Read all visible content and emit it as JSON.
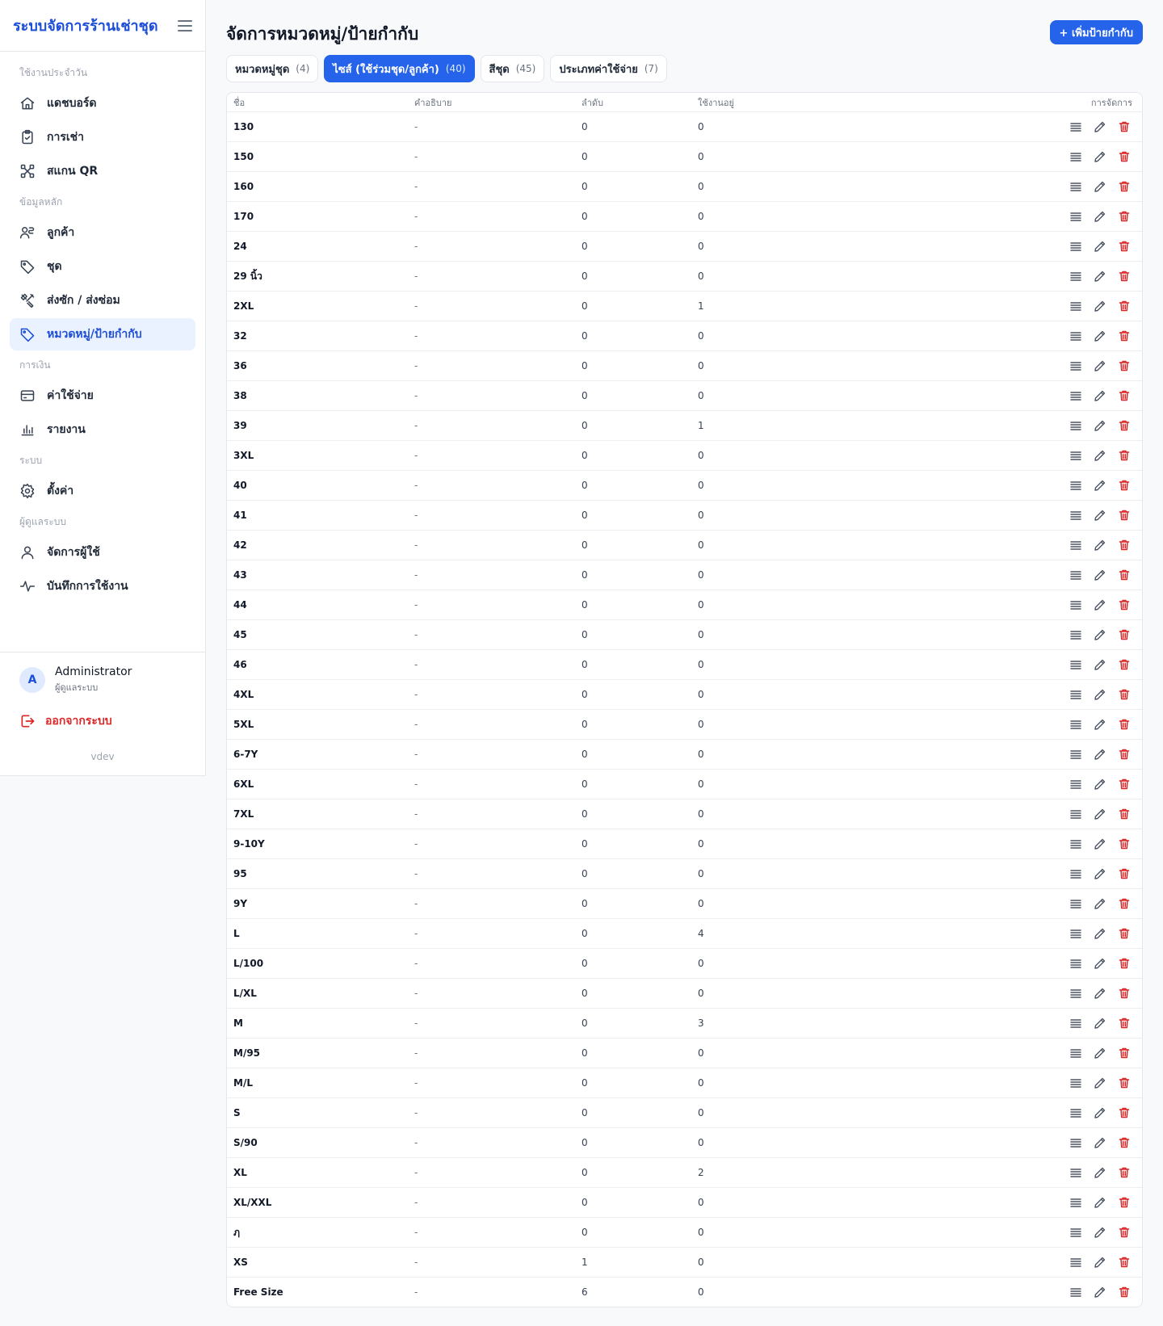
{
  "app": {
    "brand_title": "ระบบจัดการร้านเช่าชุด",
    "version": "vdev"
  },
  "sidebar": {
    "sections": [
      {
        "label": "ใช้งานประจำวัน",
        "items": [
          {
            "label": "แดชบอร์ด",
            "icon": "home-icon"
          },
          {
            "label": "การเช่า",
            "icon": "clipboard-check-icon"
          },
          {
            "label": "สแกน QR",
            "icon": "qr-scan-icon"
          }
        ]
      },
      {
        "label": "ข้อมูลหลัก",
        "items": [
          {
            "label": "ลูกค้า",
            "icon": "users-icon"
          },
          {
            "label": "ชุด",
            "icon": "tag-icon"
          },
          {
            "label": "ส่งซัก / ส่งซ่อม",
            "icon": "tools-icon"
          },
          {
            "label": "หมวดหมู่/ป้ายกำกับ",
            "icon": "tag-icon",
            "active": true
          }
        ]
      },
      {
        "label": "การเงิน",
        "items": [
          {
            "label": "ค่าใช้จ่าย",
            "icon": "wallet-icon"
          },
          {
            "label": "รายงาน",
            "icon": "bar-chart-icon"
          }
        ]
      },
      {
        "label": "ระบบ",
        "items": [
          {
            "label": "ตั้งค่า",
            "icon": "gear-icon"
          }
        ]
      },
      {
        "label": "ผู้ดูแลระบบ",
        "items": [
          {
            "label": "จัดการผู้ใช้",
            "icon": "user-icon"
          },
          {
            "label": "บันทึกการใช้งาน",
            "icon": "activity-icon"
          }
        ]
      }
    ],
    "profile": {
      "avatar_letter": "A",
      "name": "Administrator",
      "role": "ผู้ดูแลระบบ"
    },
    "logout_label": "ออกจากระบบ"
  },
  "main": {
    "title": "จัดการหมวดหมู่/ป้ายกำกับ",
    "add_button": "+ เพิ่มป้ายกำกับ",
    "tabs": [
      {
        "label": "หมวดหมู่ชุด",
        "count": "(4)",
        "active": false
      },
      {
        "label": "ไซส์ (ใช้ร่วมชุด/ลูกค้า)",
        "count": "(40)",
        "active": true
      },
      {
        "label": "สีชุด",
        "count": "(45)",
        "active": false
      },
      {
        "label": "ประเภทค่าใช้จ่าย",
        "count": "(7)",
        "active": false
      }
    ],
    "table": {
      "headers": {
        "name": "ชื่อ",
        "description": "คำอธิบาย",
        "order": "ลำดับ",
        "used": "ใช้งานอยู่",
        "actions": "การจัดการ"
      },
      "rows": [
        {
          "name": "130",
          "description": "-",
          "order": "0",
          "used": "0"
        },
        {
          "name": "150",
          "description": "-",
          "order": "0",
          "used": "0"
        },
        {
          "name": "160",
          "description": "-",
          "order": "0",
          "used": "0"
        },
        {
          "name": "170",
          "description": "-",
          "order": "0",
          "used": "0"
        },
        {
          "name": "24",
          "description": "-",
          "order": "0",
          "used": "0"
        },
        {
          "name": "29 นิ้ว",
          "description": "-",
          "order": "0",
          "used": "0"
        },
        {
          "name": "2XL",
          "description": "-",
          "order": "0",
          "used": "1"
        },
        {
          "name": "32",
          "description": "-",
          "order": "0",
          "used": "0"
        },
        {
          "name": "36",
          "description": "-",
          "order": "0",
          "used": "0"
        },
        {
          "name": "38",
          "description": "-",
          "order": "0",
          "used": "0"
        },
        {
          "name": "39",
          "description": "-",
          "order": "0",
          "used": "1"
        },
        {
          "name": "3XL",
          "description": "-",
          "order": "0",
          "used": "0"
        },
        {
          "name": "40",
          "description": "-",
          "order": "0",
          "used": "0"
        },
        {
          "name": "41",
          "description": "-",
          "order": "0",
          "used": "0"
        },
        {
          "name": "42",
          "description": "-",
          "order": "0",
          "used": "0"
        },
        {
          "name": "43",
          "description": "-",
          "order": "0",
          "used": "0"
        },
        {
          "name": "44",
          "description": "-",
          "order": "0",
          "used": "0"
        },
        {
          "name": "45",
          "description": "-",
          "order": "0",
          "used": "0"
        },
        {
          "name": "46",
          "description": "-",
          "order": "0",
          "used": "0"
        },
        {
          "name": "4XL",
          "description": "-",
          "order": "0",
          "used": "0"
        },
        {
          "name": "5XL",
          "description": "-",
          "order": "0",
          "used": "0"
        },
        {
          "name": "6-7Y",
          "description": "-",
          "order": "0",
          "used": "0"
        },
        {
          "name": "6XL",
          "description": "-",
          "order": "0",
          "used": "0"
        },
        {
          "name": "7XL",
          "description": "-",
          "order": "0",
          "used": "0"
        },
        {
          "name": "9-10Y",
          "description": "-",
          "order": "0",
          "used": "0"
        },
        {
          "name": "95",
          "description": "-",
          "order": "0",
          "used": "0"
        },
        {
          "name": "9Y",
          "description": "-",
          "order": "0",
          "used": "0"
        },
        {
          "name": "L",
          "description": "-",
          "order": "0",
          "used": "4"
        },
        {
          "name": "L/100",
          "description": "-",
          "order": "0",
          "used": "0"
        },
        {
          "name": "L/XL",
          "description": "-",
          "order": "0",
          "used": "0"
        },
        {
          "name": "M",
          "description": "-",
          "order": "0",
          "used": "3"
        },
        {
          "name": "M/95",
          "description": "-",
          "order": "0",
          "used": "0"
        },
        {
          "name": "M/L",
          "description": "-",
          "order": "0",
          "used": "0"
        },
        {
          "name": "S",
          "description": "-",
          "order": "0",
          "used": "0"
        },
        {
          "name": "S/90",
          "description": "-",
          "order": "0",
          "used": "0"
        },
        {
          "name": "XL",
          "description": "-",
          "order": "0",
          "used": "2"
        },
        {
          "name": "XL/XXL",
          "description": "-",
          "order": "0",
          "used": "0"
        },
        {
          "name": "ฦ",
          "description": "-",
          "order": "0",
          "used": "0"
        },
        {
          "name": "XS",
          "description": "-",
          "order": "1",
          "used": "0"
        },
        {
          "name": "Free Size",
          "description": "-",
          "order": "6",
          "used": "0"
        }
      ]
    }
  },
  "colors": {
    "accent": "#2563eb",
    "brand": "#1d4ed8",
    "danger": "#dc2626",
    "active_bg": "#eaf1ff"
  }
}
